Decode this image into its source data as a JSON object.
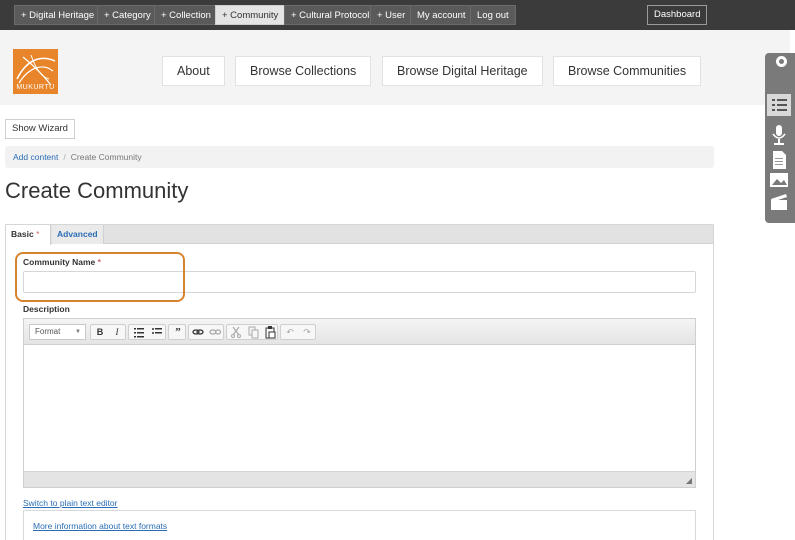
{
  "admin_bar": {
    "items": [
      {
        "label": "+ Digital Heritage"
      },
      {
        "label": "+ Category"
      },
      {
        "label": "+ Collection"
      },
      {
        "label": "+ Community",
        "active": true
      },
      {
        "label": "+ Cultural Protocol"
      },
      {
        "label": "+ User"
      },
      {
        "label": "My account"
      },
      {
        "label": "Log out"
      }
    ],
    "dashboard_label": "Dashboard"
  },
  "logo": {
    "text": "MUKURTU",
    "color": "#e8842a"
  },
  "nav": {
    "items": [
      {
        "label": "About"
      },
      {
        "label": "Browse Collections"
      },
      {
        "label": "Browse Digital Heritage"
      },
      {
        "label": "Browse Communities"
      }
    ]
  },
  "side_toolbar": {
    "icons": [
      "list-icon",
      "microphone-icon",
      "document-icon",
      "image-icon",
      "video-icon"
    ]
  },
  "wizard_button": "Show Wizard",
  "breadcrumb": {
    "items": [
      "Add content",
      "Create Community"
    ]
  },
  "page_title": "Create Community",
  "tabs": [
    {
      "label": "Basic",
      "required_mark": "*",
      "active": true
    },
    {
      "label": "Advanced"
    }
  ],
  "form": {
    "community_name": {
      "label": "Community Name",
      "required_mark": "*",
      "value": ""
    },
    "description": {
      "label": "Description",
      "value": ""
    },
    "editor": {
      "format_select": "Format",
      "buttons": [
        "B",
        "I",
        "numbered-list-icon",
        "bulleted-list-icon",
        "blockquote-icon",
        "link-icon",
        "unlink-icon",
        "cut-icon",
        "copy-icon",
        "paste-icon",
        "undo-icon",
        "redo-icon"
      ]
    },
    "switch_editor_link": "Switch to plain text editor",
    "formats_link": "More information about text formats"
  },
  "colors": {
    "accent": "#d68430",
    "link": "#2a6db5",
    "admin_bar": "#3b3b3b"
  }
}
